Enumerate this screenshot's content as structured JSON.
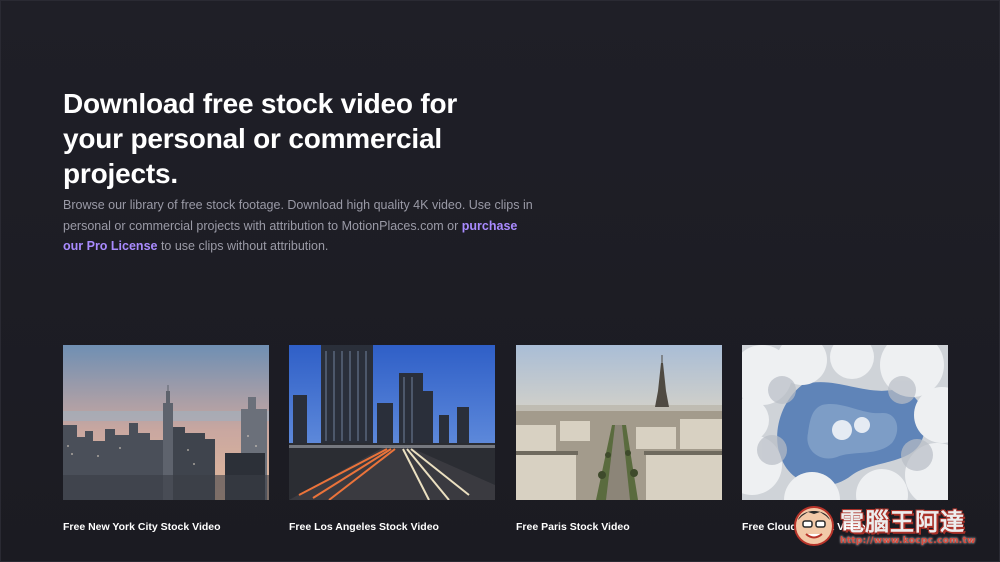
{
  "hero": {
    "title": "Download free stock video for your personal or commercial projects.",
    "description_part1": "Browse our library of free stock footage. Download high quality 4K video. Use clips in personal or commercial projects with attribution to MotionPlaces.com or ",
    "pro_link": "purchase our Pro License",
    "description_part2": " to use clips without attribution."
  },
  "cards": [
    {
      "label": "Free New York City Stock Video",
      "icon": "new-york-skyline-thumbnail"
    },
    {
      "label": "Free Los Angeles Stock Video",
      "icon": "los-angeles-highway-thumbnail"
    },
    {
      "label": "Free Paris Stock Video",
      "icon": "paris-eiffel-tower-thumbnail"
    },
    {
      "label": "Free Clouds Stock Video",
      "icon": "clouds-sky-thumbnail"
    }
  ],
  "watermark": {
    "text": "電腦王阿達",
    "url": "http://www.kocpc.com.tw"
  },
  "colors": {
    "background": "#1c1c24",
    "link": "#a98bff",
    "muted_text": "#9a9aa6"
  }
}
